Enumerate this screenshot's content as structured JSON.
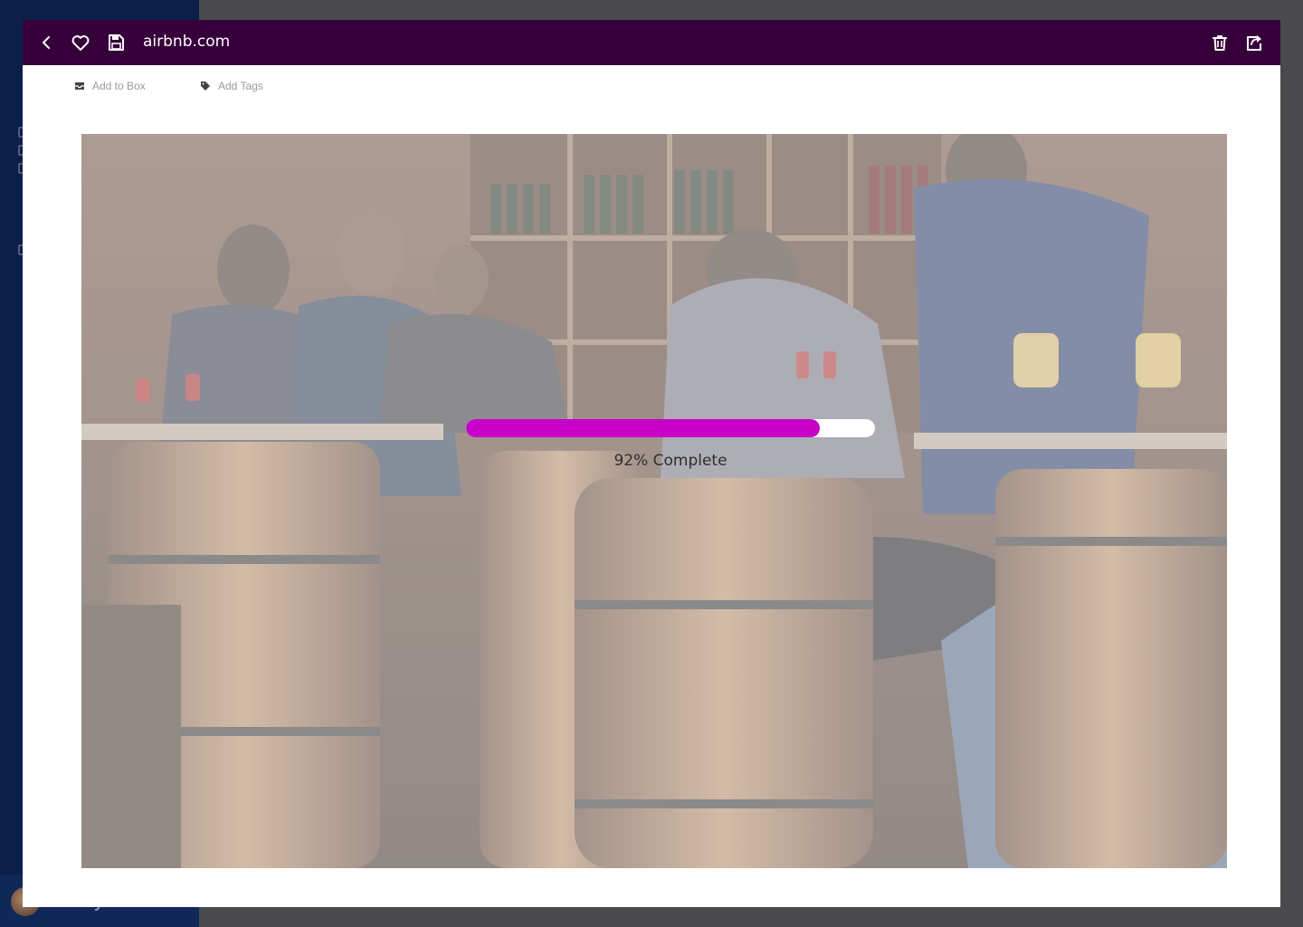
{
  "toolbar": {
    "url": "airbnb.com",
    "back_icon": "chevron-left-icon",
    "favorite_icon": "heart-icon",
    "save_icon": "floppy-disk-icon",
    "delete_icon": "trash-icon",
    "share_icon": "share-icon"
  },
  "actions": {
    "add_to_box": "Add to Box",
    "add_tags": "Add Tags"
  },
  "progress": {
    "fraction": 0.92,
    "label": "92% Complete"
  },
  "colors": {
    "topbar": "#36003a",
    "progress_fill": "#c800c8",
    "progress_track": "#ffffff"
  },
  "background_app": {
    "user_name": "Stacey Li"
  }
}
